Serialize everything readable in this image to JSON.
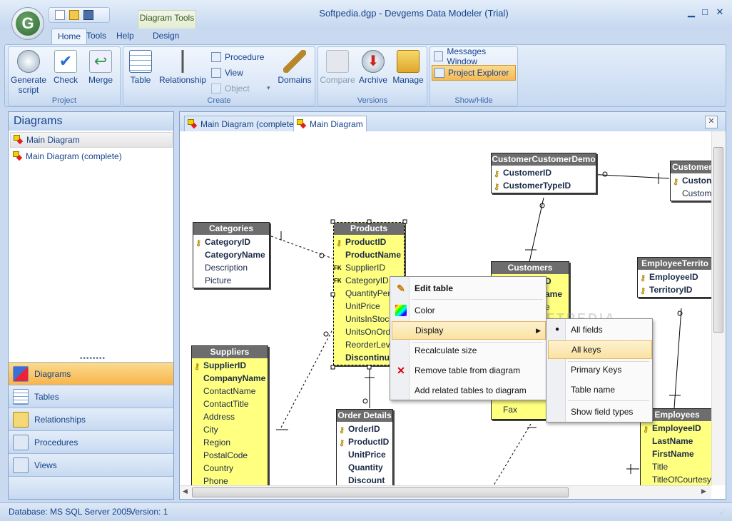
{
  "window": {
    "title": "Softpedia.dgp - Devgems Data Modeler (Trial)",
    "logo": "G",
    "minimize": "▁",
    "maximize": "□",
    "close": "✕"
  },
  "ribbon": {
    "contextual_tab": "Diagram Tools",
    "tabs": [
      "Home",
      "Tools",
      "Help",
      "Design"
    ],
    "groups": {
      "project": {
        "label": "Project",
        "buttons": [
          "Generate script",
          "Check",
          "Merge"
        ]
      },
      "create": {
        "label": "Create",
        "table": "Table",
        "relationship": "Relationship",
        "procedure": "Procedure",
        "view": "View",
        "object": "Object",
        "domains": "Domains"
      },
      "versions": {
        "label": "Versions",
        "compare": "Compare",
        "archive": "Archive",
        "manage": "Manage"
      },
      "showhide": {
        "label": "Show/Hide",
        "messages": "Messages Window",
        "explorer": "Project Explorer"
      }
    }
  },
  "sidebar": {
    "title": "Diagrams",
    "items": [
      "Main Diagram",
      "Main Diagram (complete)"
    ],
    "nav": [
      "Diagrams",
      "Tables",
      "Relationships",
      "Procedures",
      "Views"
    ]
  },
  "doc": {
    "tabs": [
      "Main Diagram (complete)",
      "Main Diagram"
    ]
  },
  "tables": {
    "categories": {
      "title": "Categories",
      "rows": [
        "CategoryID",
        "CategoryName",
        "Description",
        "Picture"
      ]
    },
    "products": {
      "title": "Products",
      "rows": [
        "ProductID",
        "ProductName",
        "SupplierID",
        "CategoryID",
        "QuantityPerUnit",
        "UnitPrice",
        "UnitsInStock",
        "UnitsOnOrder",
        "ReorderLevel",
        "Discontinued"
      ]
    },
    "suppliers": {
      "title": "Suppliers",
      "rows": [
        "SupplierID",
        "CompanyName",
        "ContactName",
        "ContactTitle",
        "Address",
        "City",
        "Region",
        "PostalCode",
        "Country",
        "Phone"
      ]
    },
    "order_details": {
      "title": "Order Details",
      "rows": [
        "OrderID",
        "ProductID",
        "UnitPrice",
        "Quantity",
        "Discount"
      ]
    },
    "customer_demo": {
      "title": "CustomerCustomerDemo",
      "rows": [
        "CustomerID",
        "CustomerTypeID"
      ]
    },
    "customer_demographics": {
      "title": "Customer",
      "rows": [
        "Custon",
        "Custome"
      ]
    },
    "customers": {
      "title": "Customers",
      "rows": [
        "D",
        "ame",
        "e",
        "",
        "",
        "",
        "",
        "",
        "",
        "",
        "Fax"
      ]
    },
    "employee_territories": {
      "title": "EmployeeTerrito",
      "rows": [
        "EmployeeID",
        "TerritoryID"
      ]
    },
    "employees": {
      "title": "Employees",
      "rows": [
        "EmployeeID",
        "LastName",
        "FirstName",
        "Title",
        "TitleOfCourtesy"
      ]
    }
  },
  "context_menu": {
    "items": [
      "Edit table",
      "Color",
      "Display",
      "Recalculate size",
      "Remove table from diagram",
      "Add related tables to diagram"
    ]
  },
  "display_submenu": {
    "items": [
      "All fields",
      "All keys",
      "Primary Keys",
      "Table name",
      "Show field types"
    ]
  },
  "status": {
    "database": "Database: MS SQL Server 2005",
    "version": "Version: 1"
  },
  "watermark": "SOFTPEDIA",
  "colors": {
    "accent": "#15428b",
    "table_fill": "#ffff80",
    "table_header": "#6d6d6d",
    "selected_nav": "#f8b54b"
  }
}
